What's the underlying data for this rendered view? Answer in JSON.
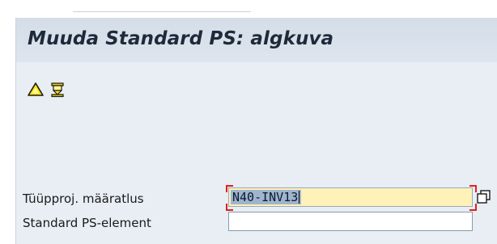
{
  "window": {
    "title": "Muuda Standard PS: alg­kuva"
  },
  "toolbar": {
    "icons": [
      {
        "name": "warning-icon"
      },
      {
        "name": "bookmark-flag-icon"
      }
    ]
  },
  "form": {
    "fields": [
      {
        "label": "Tüüpproj. määratlus",
        "value": "N40-INV13",
        "required": true,
        "focused": true,
        "has_value_help": true
      },
      {
        "label": "Standard PS-element",
        "value": "",
        "required": false,
        "focused": false,
        "has_value_help": false
      }
    ]
  },
  "colors": {
    "title_bar": "#d4dde8",
    "background": "#e8eef4",
    "required_field": "#fff2b8",
    "focus_marker": "#e02020",
    "selection": "#9fb4cf"
  }
}
